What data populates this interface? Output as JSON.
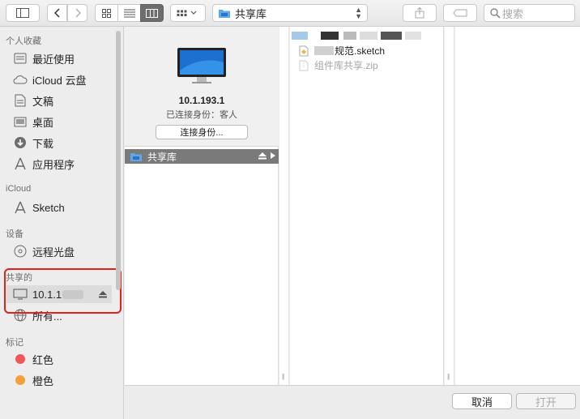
{
  "toolbar": {
    "path_label": "共享库",
    "search_placeholder": "搜索"
  },
  "sidebar": {
    "favorites_header": "个人收藏",
    "favorites": [
      {
        "label": "最近使用",
        "icon": "clock-icon"
      },
      {
        "label": "iCloud 云盘",
        "icon": "cloud-icon"
      },
      {
        "label": "文稿",
        "icon": "document-icon"
      },
      {
        "label": "桌面",
        "icon": "desktop-icon"
      },
      {
        "label": "下载",
        "icon": "download-icon"
      },
      {
        "label": "应用程序",
        "icon": "applications-icon"
      }
    ],
    "icloud_header": "iCloud",
    "icloud_items": [
      {
        "label": "Sketch",
        "icon": "sketch-icon"
      }
    ],
    "devices_header": "设备",
    "devices": [
      {
        "label": "远程光盘",
        "icon": "disc-icon"
      }
    ],
    "shared_header": "共享的",
    "shared": [
      {
        "label": "10.1.1",
        "icon": "monitor-icon"
      },
      {
        "label": "所有...",
        "icon": "network-icon"
      }
    ],
    "tags_header": "标记",
    "tags": [
      {
        "label": "红色",
        "color": "#f25757"
      },
      {
        "label": "橙色",
        "color": "#f5a13b"
      }
    ]
  },
  "host": {
    "ip": "10.1.193.1",
    "status": "已连接身份：客人",
    "connect_label": "连接身份..."
  },
  "share": {
    "label": "共享库"
  },
  "files": [
    {
      "name": "规范.sketch",
      "type": "sketch",
      "dimmed": false
    },
    {
      "name": "组件库共享.zip",
      "type": "zip",
      "dimmed": true
    }
  ],
  "buttons": {
    "cancel": "取消",
    "open": "打开"
  }
}
